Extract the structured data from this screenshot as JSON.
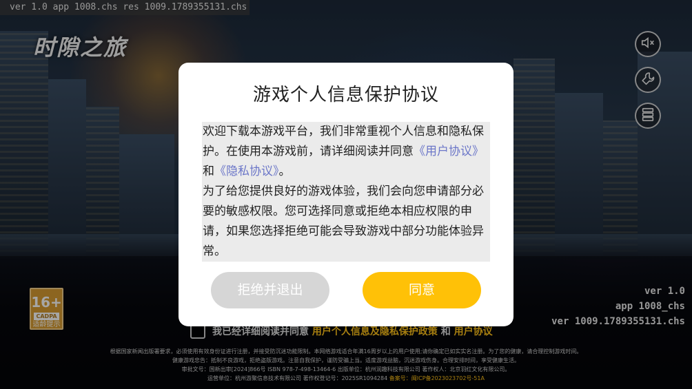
{
  "debug_bar": {
    "text": "ver 1.0 app 1008.chs res 1009.1789355131.chs"
  },
  "logo": {
    "title": "时隙之旅",
    "subtitle": ""
  },
  "side_buttons": [
    {
      "icon": "speaker-muted-icon"
    },
    {
      "icon": "wrench-icon"
    },
    {
      "icon": "server-stack-icon"
    }
  ],
  "age_badge": {
    "rating": "16+",
    "org": "CADPA",
    "tip": "适龄提示"
  },
  "version_info": {
    "ver": "ver 1.0",
    "app": "app 1008_chs",
    "res": "ver 1009.1789355131.chs"
  },
  "consent_row": {
    "prefix": "我已经详细阅读并同意",
    "link1": "用户个人信息及隐私保护政策",
    "and": "和",
    "link2": "用户协议"
  },
  "footer": {
    "line1": "根据国家新闻出版署要求，必须使用有效身份证进行注册，并接受防沉迷功能限制。本网络游戏适合年满16周岁以上的用户使用;请你确定已如实实名注册。为了您的健康，请合理控制游戏时间。",
    "line2": "健康游戏忠告：抵制不良游戏，拒绝盗版游戏。注意自我保护，谨防受骗上当。适度游戏益脑，沉迷游戏伤身。合理安排时间，享受健康生活。",
    "line3": "审批文号：国新出审[2024]866号 ISBN 978-7-498-13464-6 出版单位：杭州润趣科技有限公司 著作权人：北京羽红文化有限公司。",
    "line4_prefix": "运营单位：杭州游聚信息技术有限公司 著作权登记号：2025SR1094284 ",
    "line4_highlight": "备案号：闽ICP备2023023702号-51A"
  },
  "dialog": {
    "title": "游戏个人信息保护协议",
    "p1_a": "欢迎下载本游戏平台，我们非常重视个人信息和隐私保护。在使用本游戏前，请详细阅读并同意",
    "p1_link1": "《用户协议》",
    "p1_and": "和",
    "p1_link2": "《隐私协议》",
    "p1_end": "。",
    "p2": "为了给您提供良好的游戏体验，我们会向您申请部分必要的敏感权限。您可选择同意或拒绝本相应权限的申请，如果您选择拒绝可能会导致游戏中部分功能体验异常。",
    "reject_label": "拒绝并退出",
    "agree_label": "同意"
  },
  "colors": {
    "accent": "#ffc107",
    "link": "#6b76c8",
    "reject_bg": "#d6d6d6",
    "footer_highlight": "#ffc21a"
  }
}
